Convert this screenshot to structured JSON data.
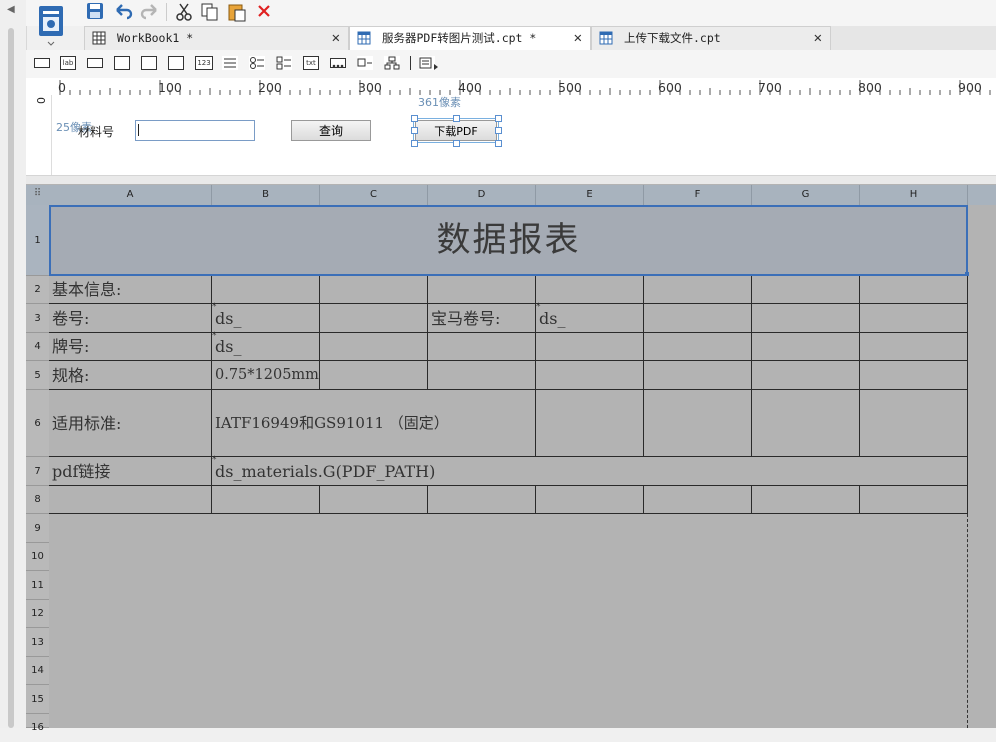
{
  "tabs": [
    {
      "label": "WorkBook1 *"
    },
    {
      "label": "服务器PDF转图片测试.cpt *"
    },
    {
      "label": "上传下载文件.cpt"
    }
  ],
  "widget_bar": {
    "items": [
      "lab",
      "123",
      "txt"
    ]
  },
  "ruler": {
    "marks": [
      "0",
      "100",
      "200",
      "300",
      "400",
      "500",
      "600",
      "700",
      "800",
      "900"
    ],
    "vertical_zero": "0"
  },
  "param_panel": {
    "size_label_top": "361像素",
    "size_label_left": "25像素",
    "material_label": "材料号",
    "material_input_value": "",
    "query_button": "查询",
    "download_button": "下载PDF"
  },
  "sheet": {
    "columns": [
      "A",
      "B",
      "C",
      "D",
      "E",
      "F",
      "G",
      "H"
    ],
    "rows": [
      "1",
      "2",
      "3",
      "4",
      "5",
      "6",
      "7",
      "8",
      "9",
      "10",
      "11",
      "12",
      "13",
      "14",
      "15",
      "16"
    ],
    "title": "数据报表",
    "cells": {
      "r2_a": "基本信息:",
      "r3_a": "卷号:",
      "r3_b": "ds_",
      "r3_d": "宝马卷号:",
      "r3_e": "ds_",
      "r4_a": "牌号:",
      "r4_b": "ds_",
      "r5_a": "规格:",
      "r5_b": "0.75*1205mm",
      "r6_a": "适用标准:",
      "r6_b": "IATF16949和GS91011 （固定）",
      "r7_a": "pdf链接",
      "r7_b": "ds_materials.G(PDF_PATH)"
    }
  },
  "colors": {
    "accent": "#3b6fb8",
    "sheet_bg": "#b3b3b3",
    "header_bg": "#a8b3be",
    "title_bg": "#a5abb4",
    "close_red": "#e02020",
    "tool_blue": "#2f6bb3"
  }
}
